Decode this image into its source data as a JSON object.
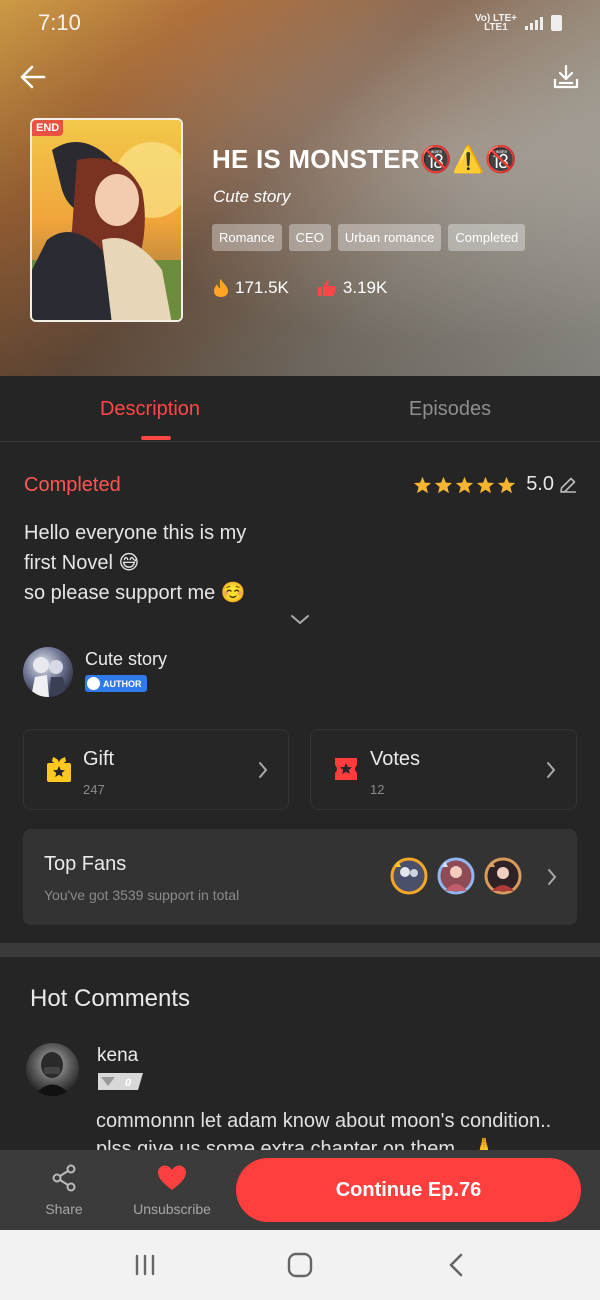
{
  "status_bar": {
    "time": "7:10",
    "network_top": "Vo) LTE+",
    "network_bottom": "LTE1"
  },
  "header": {
    "back_icon": "arrow-left-icon",
    "download_icon": "download-icon",
    "cover_badge": "END",
    "title": "HE IS MONSTER🔞⚠️🔞",
    "subtitle": "Cute story",
    "tags": [
      "Romance",
      "CEO",
      "Urban romance",
      "Completed"
    ],
    "views": "171.5K",
    "likes": "3.19K"
  },
  "tabs": [
    {
      "label": "Description",
      "active": true
    },
    {
      "label": "Episodes",
      "active": false
    }
  ],
  "description": {
    "status": "Completed",
    "rating": "5.0",
    "stars": 5,
    "text": "Hello everyone this is my\nfirst Novel 😅\nso please support me ☺️"
  },
  "author": {
    "name": "Cute story",
    "badge": "AUTHOR"
  },
  "gift": {
    "label": "Gift",
    "count": "247"
  },
  "votes": {
    "label": "Votes",
    "count": "12"
  },
  "top_fans": {
    "title": "Top Fans",
    "subtitle": "You've got 3539 support in total"
  },
  "comments": {
    "title": "Hot Comments",
    "items": [
      {
        "user": "kena",
        "level": "0",
        "text": "commonnn let adam know about moon's condition.. plss give us some extra chapter on them.. 🙏"
      }
    ]
  },
  "bottom_bar": {
    "share_label": "Share",
    "unsubscribe_label": "Unsubscribe",
    "continue_label": "Continue Ep.76"
  },
  "colors": {
    "accent": "#ff3e3e",
    "star": "#f5b530",
    "background": "#252525"
  }
}
